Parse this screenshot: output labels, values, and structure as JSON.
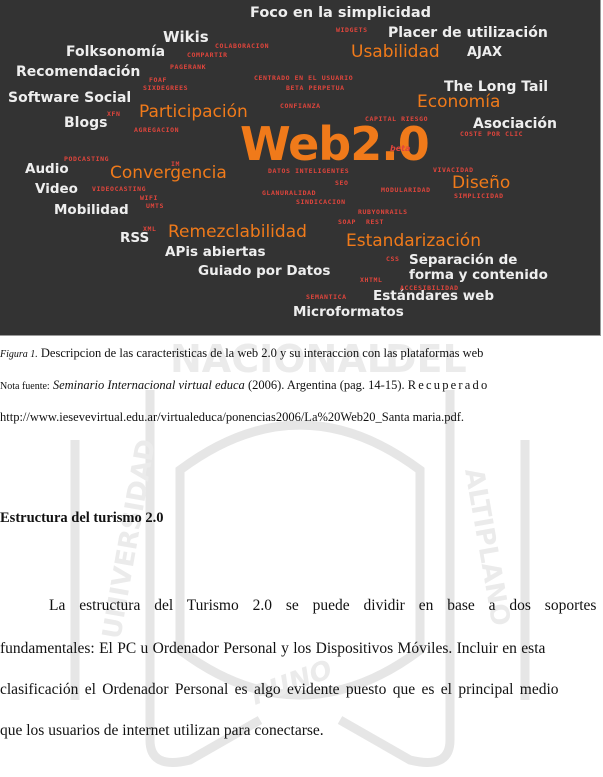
{
  "figure": {
    "center_label": "Web2.0",
    "beta_label": "beta",
    "white_tags": [
      "Foco en la simplicidad",
      "Wikis",
      "Placer de utilización",
      "Folksonomía",
      "AJAX",
      "Recomendación",
      "The Long Tail",
      "Software Social",
      "Blogs",
      "Asociación",
      "Audio",
      "Video",
      "Mobilidad",
      "RSS",
      "APis abiertas",
      "Guiado por Datos",
      "Separación de",
      "forma y contenido",
      "Estándares web",
      "Microformatos"
    ],
    "orange_tags": [
      "Usabilidad",
      "Participación",
      "Economía",
      "Convergencia",
      "Diseño",
      "Remezclabilidad",
      "Estandarización"
    ],
    "red_tags": [
      "WIDGETS",
      "COLABORACION",
      "COMPARTIR",
      "PAGERANK",
      "CENTRADO EN EL USUARIO",
      "FOAF",
      "SIXDEGREES",
      "BETA PERPETUA",
      "CONFIANZA",
      "XFN",
      "CAPITAL RIESGO",
      "AGREGACION",
      "COSTE POR CLIC",
      "PODCASTING",
      "IM",
      "DATOS INTELIGENTES",
      "VIVACIDAD",
      "VIDEOCASTING",
      "SEO",
      "GLANURALIDAD",
      "MODULARIDAD",
      "SIMPLICIDAD",
      "WIFI",
      "UMTS",
      "SINDICACION",
      "RUBYONRAILS",
      "XML",
      "SOAP",
      "REST",
      "CSS",
      "XHTML",
      "ACCESIBILIDAD",
      "SEMANTICA"
    ]
  },
  "caption": {
    "label": "Figura 1.",
    "text": " Descripcion de las caracteristicas de la web 2.0 y su interaccion con las plataformas web"
  },
  "note": {
    "label": "Nota fuente:",
    "title": "Seminario Internacional virtual educa",
    "rest": " (2006). Argentina (pag. 14-15). ",
    "recuperado": "Recuperado",
    "url": "http://www.iesevevirtual.edu.ar/virtualeduca/ponencias2006/La%20Web20_Santa maria.pdf."
  },
  "section": {
    "heading": "Estructura del turismo 2.0",
    "paragraph_lines": [
      "La estructura del Turismo 2.0 se puede dividir en base a dos soportes",
      "fundamentales: El PC u Ordenador Personal y los Dispositivos Móviles. Incluir en esta",
      "clasificación el Ordenador Personal es algo evidente puesto que es el  principal medio",
      "que los usuarios de internet utilizan para conectarse."
    ]
  },
  "watermark": {
    "words": [
      "NACIONAL",
      "DEL",
      "UNIVERSIDAD",
      "ALTIPLANO",
      "PUNO"
    ]
  }
}
